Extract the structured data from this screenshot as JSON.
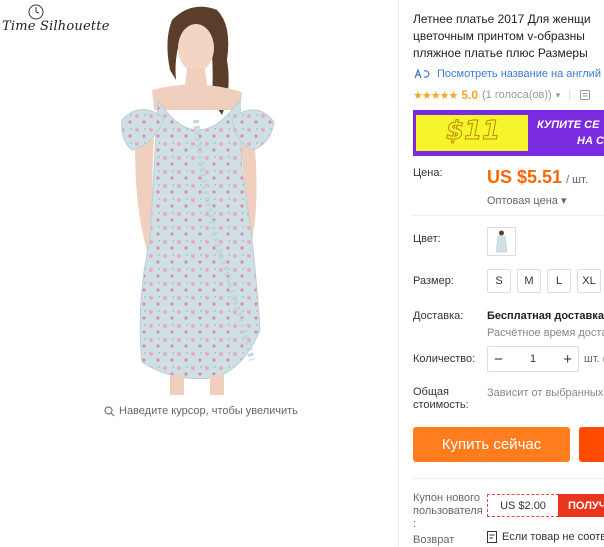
{
  "brand": {
    "name": "Time Silhouette"
  },
  "gallery": {
    "zoom_hint": "Наведите курсор, чтобы увеличить"
  },
  "product": {
    "title_lines": [
      "Летнее платье 2017 Для женщи",
      "цветочным принтом v-образны",
      "пляжное платье плюс Размеры"
    ],
    "translate_link": "Посмотреть название на англий",
    "rating_value": "5.0",
    "rating_count": "(1 голоса(ов))",
    "stars": "★★★★★",
    "rating_sep": "|"
  },
  "banner": {
    "price": "$11",
    "text_line1": "КУПИТЕ СЕ",
    "text_line2": "НА С",
    "colors": {
      "background": "#7a2be0",
      "accent": "#f6f42a"
    }
  },
  "price": {
    "label": "Цена:",
    "value": "US $5.51",
    "unit": "/ шт.",
    "wholesale": "Оптовая цена ▾"
  },
  "color": {
    "label": "Цвет:"
  },
  "size": {
    "label": "Размер:",
    "options": [
      "S",
      "M",
      "L",
      "XL"
    ]
  },
  "shipping": {
    "label": "Доставка:",
    "title": "Бесплатная доставка н",
    "subtitle": "Расчётное время доста"
  },
  "quantity": {
    "label": "Количество:",
    "minus": "−",
    "value": "1",
    "plus": "+",
    "unit": "шт. ("
  },
  "total": {
    "label_line1": "Общая",
    "label_line2": "стоимость:",
    "value": "Зависит от выбранных"
  },
  "actions": {
    "buy_now": "Купить сейчас",
    "buy_color": "#ff7d1e"
  },
  "coupon": {
    "label_line1": "Купон нового",
    "label_line2": "пользователя",
    "label_line3": ":",
    "amount": "US $2.00",
    "get": "ПОЛУЧ"
  },
  "returns": {
    "label": "Возврат",
    "text": "Если товар не соотв"
  }
}
